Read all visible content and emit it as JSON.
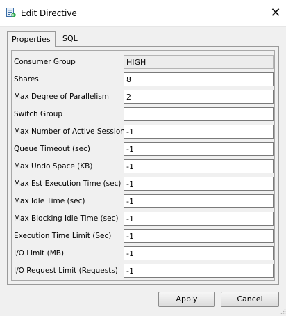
{
  "window": {
    "title": "Edit Directive",
    "icon": "edit-directive-icon",
    "close_symbol": "✕"
  },
  "tabs": [
    {
      "label": "Properties",
      "active": true
    },
    {
      "label": "SQL",
      "active": false
    }
  ],
  "form": {
    "rows": [
      {
        "label": "Consumer Group",
        "value": "HIGH",
        "readonly": true
      },
      {
        "label": "Shares",
        "value": "8"
      },
      {
        "label": "Max Degree of Parallelism",
        "value": "2"
      },
      {
        "label": "Switch Group",
        "value": ""
      },
      {
        "label": "Max Number of Active Sessions",
        "value": "-1"
      },
      {
        "label": "Queue Timeout (sec)",
        "value": "-1"
      },
      {
        "label": "Max Undo Space (KB)",
        "value": "-1"
      },
      {
        "label": "Max Est Execution Time (sec)",
        "value": "-1"
      },
      {
        "label": "Max Idle Time (sec)",
        "value": "-1"
      },
      {
        "label": "Max Blocking Idle Time (sec)",
        "value": "-1"
      },
      {
        "label": "Execution Time Limit (Sec)",
        "value": "-1"
      },
      {
        "label": "I/O Limit (MB)",
        "value": "-1"
      },
      {
        "label": "I/O Request Limit (Requests)",
        "value": "-1"
      }
    ]
  },
  "buttons": {
    "apply_label": "Apply",
    "cancel_label": "Cancel"
  },
  "colors": {
    "background": "#f0f0f0",
    "field_border": "#7a7a7a",
    "readonly_field": "#ececec"
  }
}
